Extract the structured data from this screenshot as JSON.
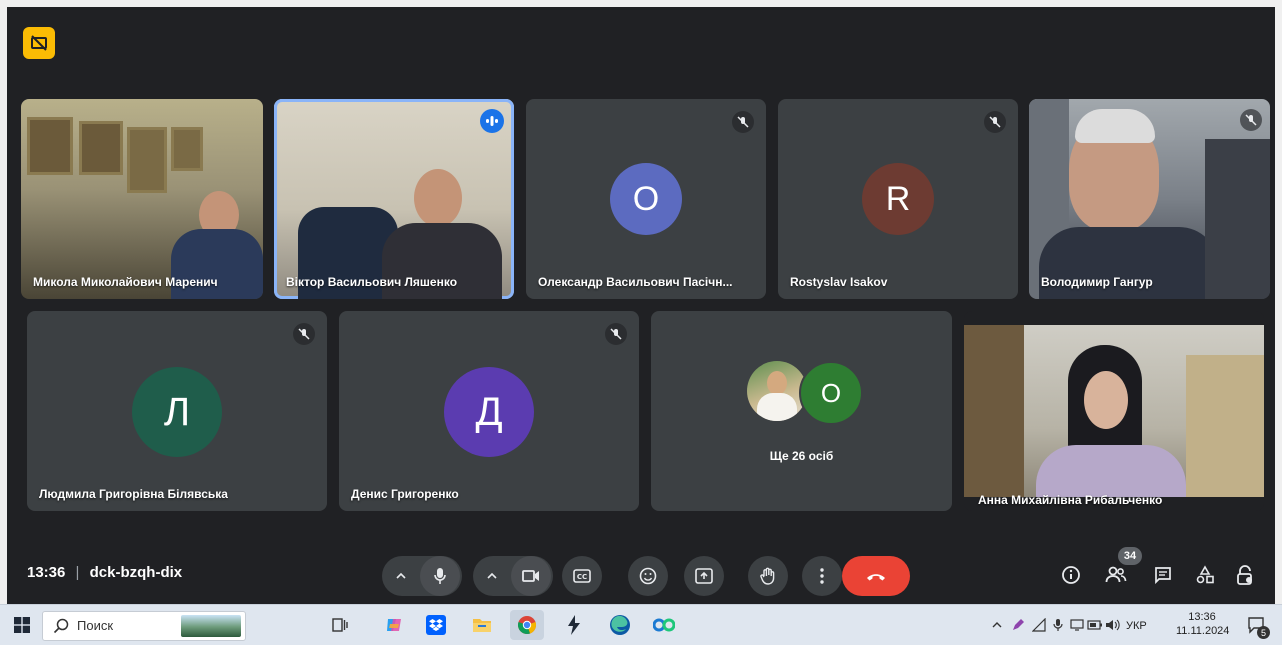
{
  "colors": {
    "meet_bg": "#202124",
    "tile_bg": "#3c4043",
    "accent_blue": "#1a73e8",
    "end_call": "#ea4335",
    "rec_badge": "#fbbc04"
  },
  "participants": [
    {
      "name": "Микола Миколайович Маренич",
      "type": "video",
      "muted": false
    },
    {
      "name": "Віктор Васильович Ляшенко",
      "type": "video",
      "speaking": true
    },
    {
      "name": "Олександр Васильович Пасічн...",
      "type": "avatar",
      "initial": "O",
      "color": "#5c6bc0",
      "muted": true
    },
    {
      "name": "Rostyslav Isakov",
      "type": "avatar",
      "initial": "R",
      "color": "#6d3b32",
      "muted": true
    },
    {
      "name": "Володимир Гангур",
      "type": "video",
      "muted": true
    },
    {
      "name": "Людмила Григорівна Білявська",
      "type": "avatar",
      "initial": "Л",
      "color": "#1f5d4b",
      "muted": true
    },
    {
      "name": "Денис Григоренко",
      "type": "avatar",
      "initial": "Д",
      "color": "#5b3cb0",
      "muted": true
    },
    {
      "name": "Ще 26 осіб",
      "type": "group",
      "initial": "O",
      "color": "#2e7d32"
    },
    {
      "name": "Анна Михайлівна Рибальченко",
      "type": "video",
      "muted": false
    }
  ],
  "call": {
    "time": "13:36",
    "separator": "|",
    "meeting_code": "dck-bzqh-dix",
    "participants_count": "34"
  },
  "controls": [
    "mic-options",
    "microphone",
    "camera-options",
    "camera",
    "captions",
    "emoji",
    "present",
    "raise-hand",
    "more-options",
    "leave-call"
  ],
  "right_controls": [
    "meeting-info",
    "people",
    "chat",
    "activities",
    "host-controls"
  ],
  "taskbar": {
    "search_placeholder": "Поиск",
    "language": "УКР",
    "time": "13:36",
    "date": "11.11.2024",
    "notification_count": "5"
  }
}
